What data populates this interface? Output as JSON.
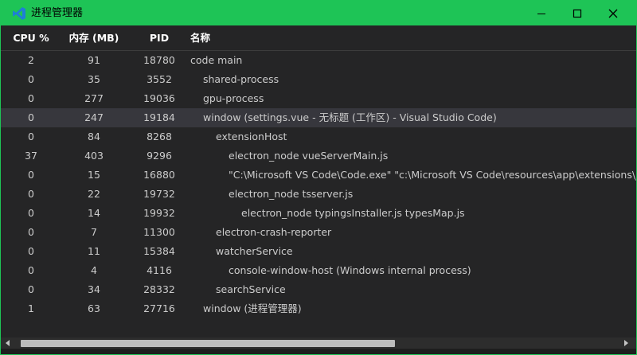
{
  "window": {
    "title": "进程管理器",
    "app_icon": "vscode-icon",
    "accent_color": "#1ec456"
  },
  "header": {
    "cpu": "CPU %",
    "memory": "内存 (MB)",
    "pid": "PID",
    "name": "名称"
  },
  "rows": [
    {
      "cpu": "2",
      "mem": "91",
      "pid": "18780",
      "name": "code main",
      "indent": 0
    },
    {
      "cpu": "0",
      "mem": "35",
      "pid": "3552",
      "name": "shared-process",
      "indent": 1
    },
    {
      "cpu": "0",
      "mem": "277",
      "pid": "19036",
      "name": "gpu-process",
      "indent": 1
    },
    {
      "cpu": "0",
      "mem": "247",
      "pid": "19184",
      "name": "window (settings.vue - 无标题 (工作区) - Visual Studio Code)",
      "indent": 1,
      "selected": true
    },
    {
      "cpu": "0",
      "mem": "84",
      "pid": "8268",
      "name": "extensionHost",
      "indent": 2
    },
    {
      "cpu": "37",
      "mem": "403",
      "pid": "9296",
      "name": "electron_node vueServerMain.js",
      "indent": 3
    },
    {
      "cpu": "0",
      "mem": "15",
      "pid": "16880",
      "name": "\"C:\\Microsoft VS Code\\Code.exe\" \"c:\\Microsoft VS Code\\resources\\app\\extensions\\json-l",
      "indent": 3
    },
    {
      "cpu": "0",
      "mem": "22",
      "pid": "19732",
      "name": "electron_node tsserver.js",
      "indent": 3
    },
    {
      "cpu": "0",
      "mem": "14",
      "pid": "19932",
      "name": "electron_node typingsInstaller.js typesMap.js",
      "indent": 4
    },
    {
      "cpu": "0",
      "mem": "7",
      "pid": "11300",
      "name": "electron-crash-reporter",
      "indent": 2
    },
    {
      "cpu": "0",
      "mem": "11",
      "pid": "15384",
      "name": "watcherService",
      "indent": 2
    },
    {
      "cpu": "0",
      "mem": "4",
      "pid": "4116",
      "name": "console-window-host (Windows internal process)",
      "indent": 3
    },
    {
      "cpu": "0",
      "mem": "34",
      "pid": "28332",
      "name": "searchService",
      "indent": 2
    },
    {
      "cpu": "1",
      "mem": "63",
      "pid": "27716",
      "name": "window (进程管理器)",
      "indent": 1
    }
  ]
}
